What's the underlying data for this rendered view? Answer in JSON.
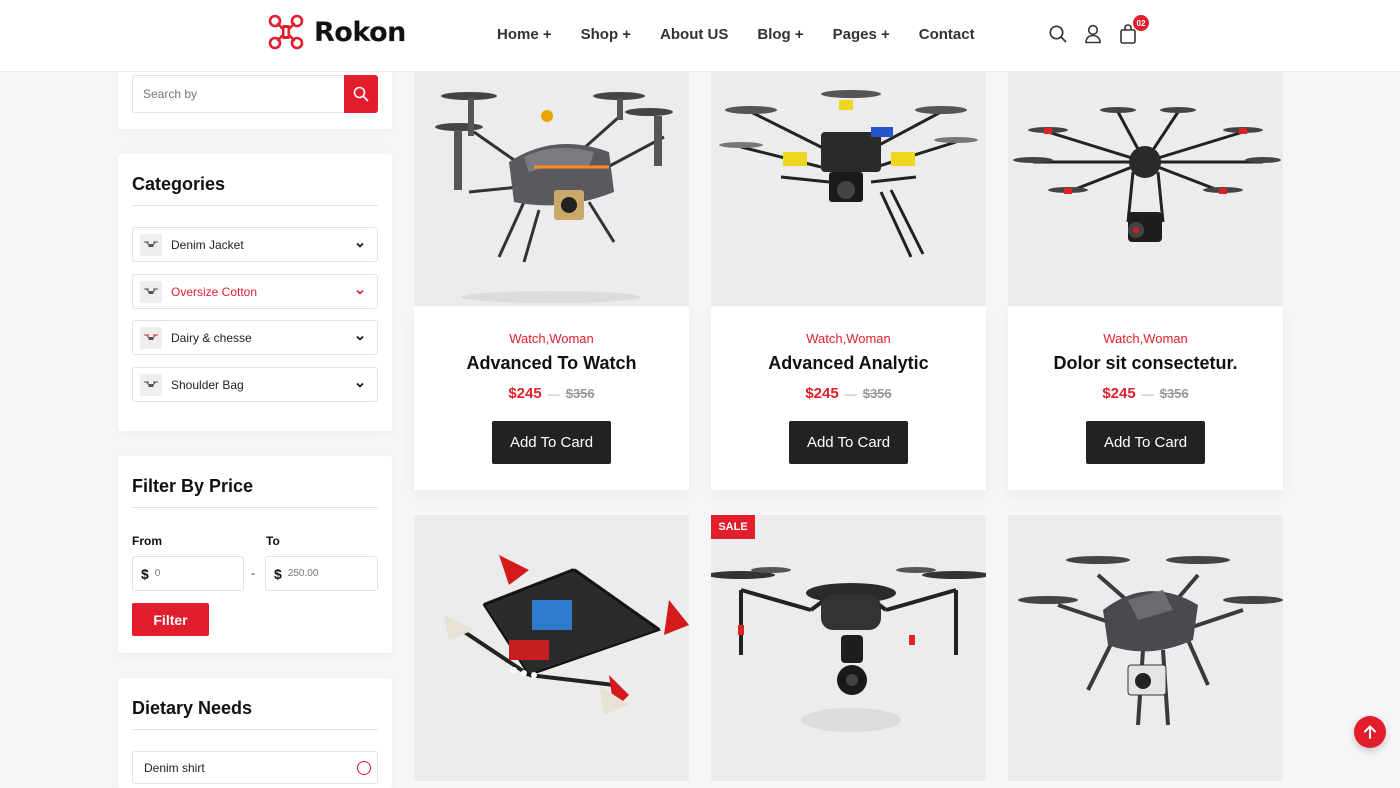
{
  "brand": {
    "name": "Rokon",
    "accent": "#e21e2d",
    "dark": "#222222"
  },
  "nav": {
    "items": [
      {
        "label": "Home +"
      },
      {
        "label": "Shop +"
      },
      {
        "label": "About US"
      },
      {
        "label": "Blog +"
      },
      {
        "label": "Pages +"
      },
      {
        "label": "Contact"
      }
    ]
  },
  "header": {
    "cart_count": "02",
    "icons": [
      "search-icon",
      "user-icon",
      "shopping-bag-icon"
    ]
  },
  "search": {
    "placeholder": "Search by"
  },
  "categories": {
    "title": "Categories",
    "items": [
      {
        "label": "Denim Jacket"
      },
      {
        "label": "Oversize Cotton"
      },
      {
        "label": "Dairy & chesse"
      },
      {
        "label": "Shoulder Bag"
      }
    ]
  },
  "price_filter": {
    "title": "Filter By Price",
    "from_label": "From",
    "to_label": "To",
    "currency": "$",
    "from_value": "0",
    "to_value": "250.00",
    "dash": "-",
    "button": "Filter"
  },
  "dietary": {
    "title": "Dietary Needs",
    "items": [
      {
        "label": "Denim shirt"
      }
    ]
  },
  "products": [
    {
      "category": "Watch,Woman",
      "title": "Advanced To Watch",
      "price": "$245",
      "old_price": "$356",
      "button": "Add To Card"
    },
    {
      "category": "Watch,Woman",
      "title": "Advanced Analytic",
      "price": "$245",
      "old_price": "$356",
      "button": "Add To Card"
    },
    {
      "category": "Watch,Woman",
      "title": "Dolor sit consectetur.",
      "price": "$245",
      "old_price": "$356",
      "button": "Add To Card"
    },
    {
      "badge": ""
    },
    {
      "badge": "SALE"
    },
    {
      "badge": ""
    }
  ],
  "price_separator": "—"
}
